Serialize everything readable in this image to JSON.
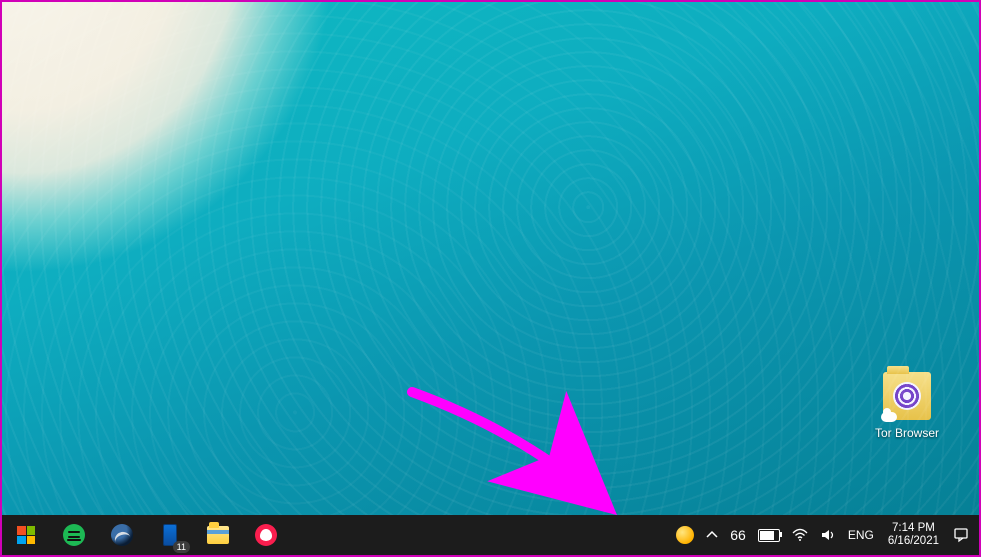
{
  "desktop": {
    "icons": [
      {
        "name": "tor-browser-shortcut",
        "label": "Tor Browser"
      }
    ]
  },
  "annotation": {
    "type": "arrow",
    "color": "#ff00ff",
    "target": "weather-tray-icon"
  },
  "taskbar": {
    "left": [
      {
        "name": "start-button",
        "icon": "windows-logo"
      },
      {
        "name": "spotify-taskbar",
        "icon": "spotify-icon"
      },
      {
        "name": "steam-taskbar",
        "icon": "steam-icon"
      },
      {
        "name": "your-phone-taskbar",
        "icon": "phone-icon",
        "badge": "11"
      },
      {
        "name": "file-explorer-taskbar",
        "icon": "folder-icon"
      },
      {
        "name": "opera-gx-taskbar",
        "icon": "opera-icon"
      }
    ],
    "tray": {
      "weather_temp": "66",
      "language": "ENG",
      "time": "7:14 PM",
      "date": "6/16/2021"
    }
  }
}
